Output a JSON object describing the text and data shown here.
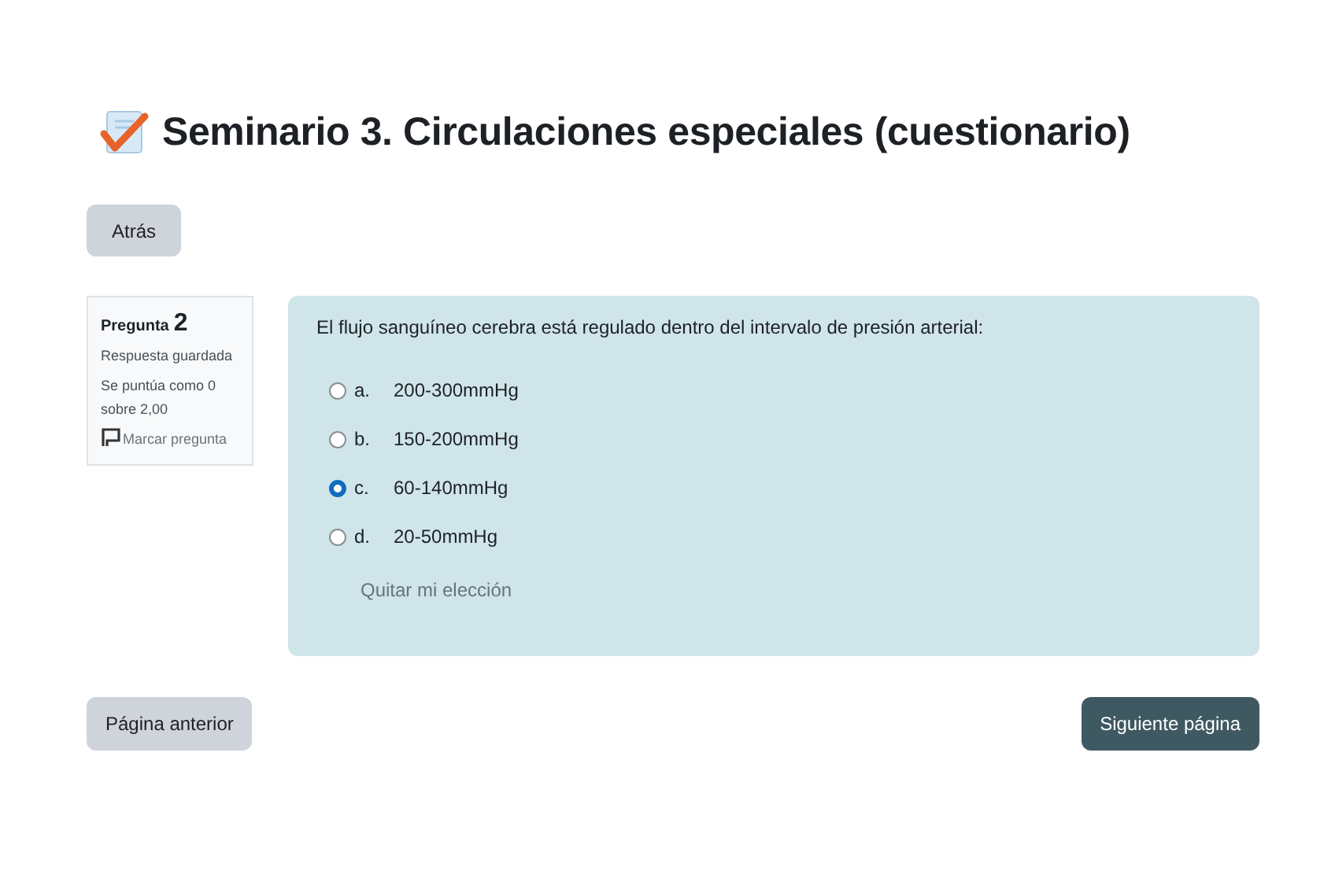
{
  "title": "Seminario 3. Circulaciones especiales (cuestionario)",
  "back_button": "Atrás",
  "question_info": {
    "label": "Pregunta",
    "number": "2",
    "state": "Respuesta guardada",
    "grade": "Se puntúa como 0 sobre 2,00",
    "flag": "Marcar pregunta"
  },
  "question": {
    "text": "El flujo sanguíneo cerebra está regulado dentro del intervalo de presión arterial:",
    "options": [
      {
        "letter": "a.",
        "text": "200-300mmHg",
        "selected": false
      },
      {
        "letter": "b.",
        "text": "150-200mmHg",
        "selected": false
      },
      {
        "letter": "c.",
        "text": "60-140mmHg",
        "selected": true
      },
      {
        "letter": "d.",
        "text": "20-50mmHg",
        "selected": false
      }
    ],
    "clear_choice": "Quitar mi elección"
  },
  "nav": {
    "previous": "Página anterior",
    "next": "Siguiente página"
  }
}
